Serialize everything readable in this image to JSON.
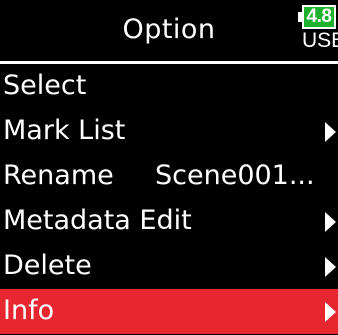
{
  "header": {
    "title": "Option"
  },
  "battery": {
    "value": "4.8",
    "source": "USB",
    "color": "#1fb02e"
  },
  "menu": {
    "items": [
      {
        "label": "Select",
        "value": "",
        "has_submenu": false,
        "selected": false
      },
      {
        "label": "Mark List",
        "value": "",
        "has_submenu": true,
        "selected": false
      },
      {
        "label": "Rename",
        "value": "Scene001...",
        "has_submenu": false,
        "selected": false
      },
      {
        "label": "Metadata Edit",
        "value": "",
        "has_submenu": true,
        "selected": false
      },
      {
        "label": "Delete",
        "value": "",
        "has_submenu": true,
        "selected": false
      },
      {
        "label": "Info",
        "value": "",
        "has_submenu": true,
        "selected": true
      }
    ]
  },
  "colors": {
    "background": "#000000",
    "highlight": "#e8262f",
    "text": "#ffffff"
  },
  "icons": {
    "submenu": "chevron-right-icon",
    "battery": "battery-icon"
  }
}
